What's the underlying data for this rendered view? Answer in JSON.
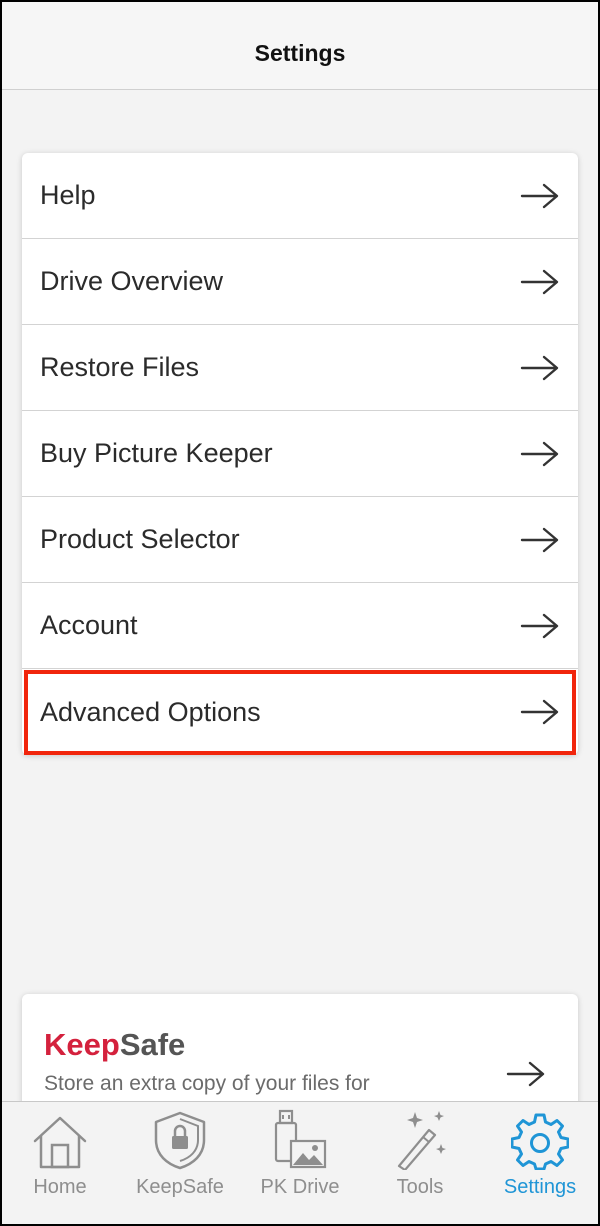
{
  "header": {
    "title": "Settings"
  },
  "menu": {
    "items": [
      {
        "label": "Help"
      },
      {
        "label": "Drive Overview"
      },
      {
        "label": "Restore Files"
      },
      {
        "label": "Buy Picture Keeper"
      },
      {
        "label": "Product Selector"
      },
      {
        "label": "Account"
      },
      {
        "label": "Advanced Options",
        "highlighted": true
      }
    ],
    "item_icon": "arrow-right-icon"
  },
  "promo": {
    "title_part1": "Keep",
    "title_part2": "Safe",
    "description": "Store an extra copy of your files for",
    "icon": "arrow-right-icon"
  },
  "tabbar": {
    "tabs": [
      {
        "label": "Home",
        "icon": "home-icon"
      },
      {
        "label": "KeepSafe",
        "icon": "shield-lock-icon"
      },
      {
        "label": "PK Drive",
        "icon": "usb-drive-icon"
      },
      {
        "label": "Tools",
        "icon": "magic-wand-icon"
      },
      {
        "label": "Settings",
        "icon": "gear-icon",
        "active": true
      }
    ]
  },
  "colors": {
    "accent": "#1f95d6",
    "highlight": "#f1250c",
    "brand_red": "#d4213d",
    "inactive": "#8e8e8e"
  }
}
